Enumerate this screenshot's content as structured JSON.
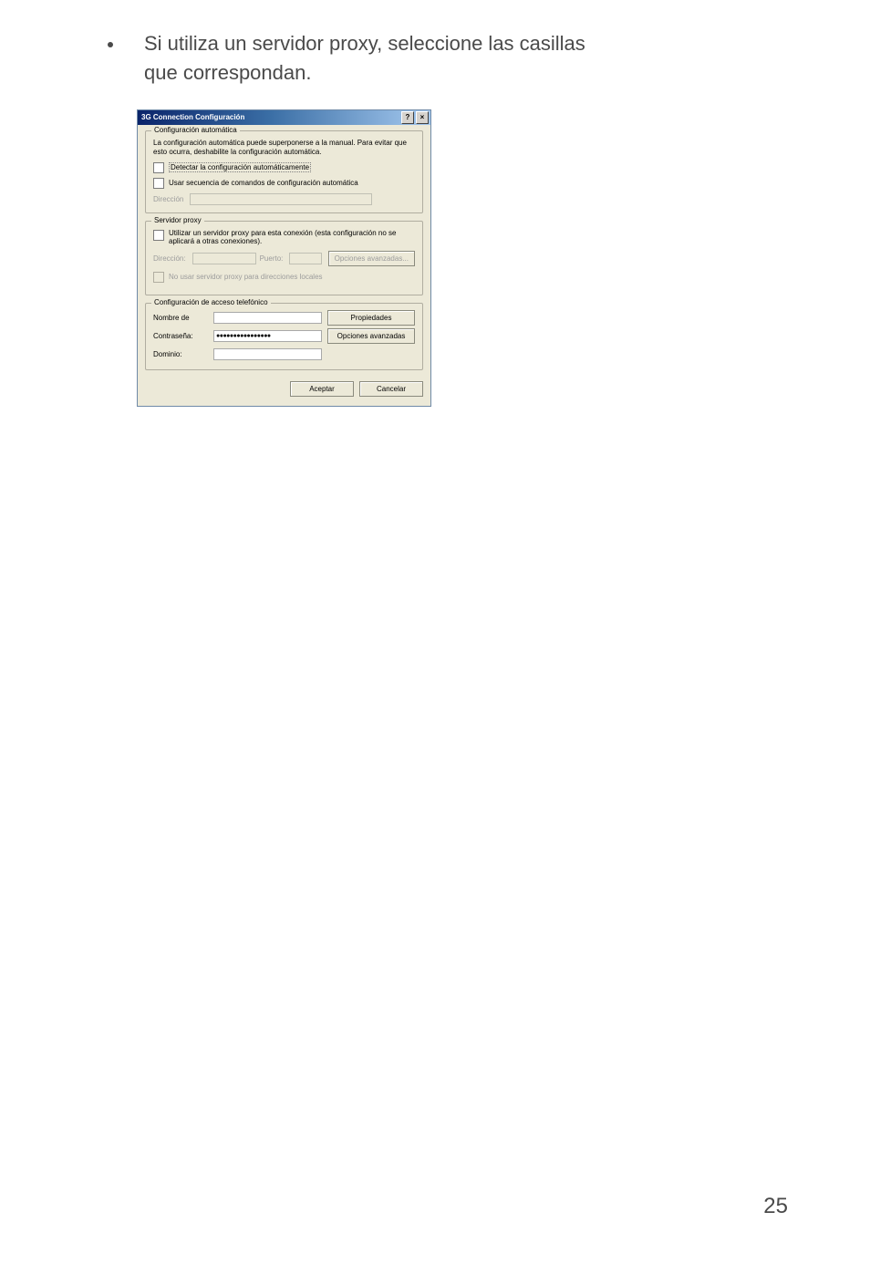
{
  "instruction": "Si utiliza un servidor proxy, seleccione las casillas que corre­spondan.",
  "page_number": "25",
  "dialog": {
    "title": "3G Connection Configuración",
    "help_btn": "?",
    "close_btn": "×",
    "auto_group": {
      "legend": "Configuración automática",
      "description": "La configuración automática puede superponerse a la manual. Para evitar que esto ocurra, deshabilite la configuración automática.",
      "detect_label": "Detectar la configuración automáticamente",
      "script_label": "Usar secuencia de comandos de configuración automática",
      "address_label": "Dirección"
    },
    "proxy_group": {
      "legend": "Servidor proxy",
      "use_proxy_label": "Utilizar un servidor proxy para esta conexión (esta configuración no se aplicará a otras conexiones).",
      "address_label": "Dirección:",
      "port_label": "Puerto:",
      "advanced_label": "Opciones avanzadas...",
      "bypass_local_label": "No usar servidor proxy para direcciones locales"
    },
    "dialup_group": {
      "legend": "Configuración de acceso telefónico",
      "username_label": "Nombre de",
      "password_label": "Contraseña:",
      "password_value": "●●●●●●●●●●●●●●●●",
      "domain_label": "Dominio:",
      "properties_label": "Propiedades",
      "advanced_label": "Opciones avanzadas"
    },
    "ok_label": "Aceptar",
    "cancel_label": "Cancelar"
  }
}
